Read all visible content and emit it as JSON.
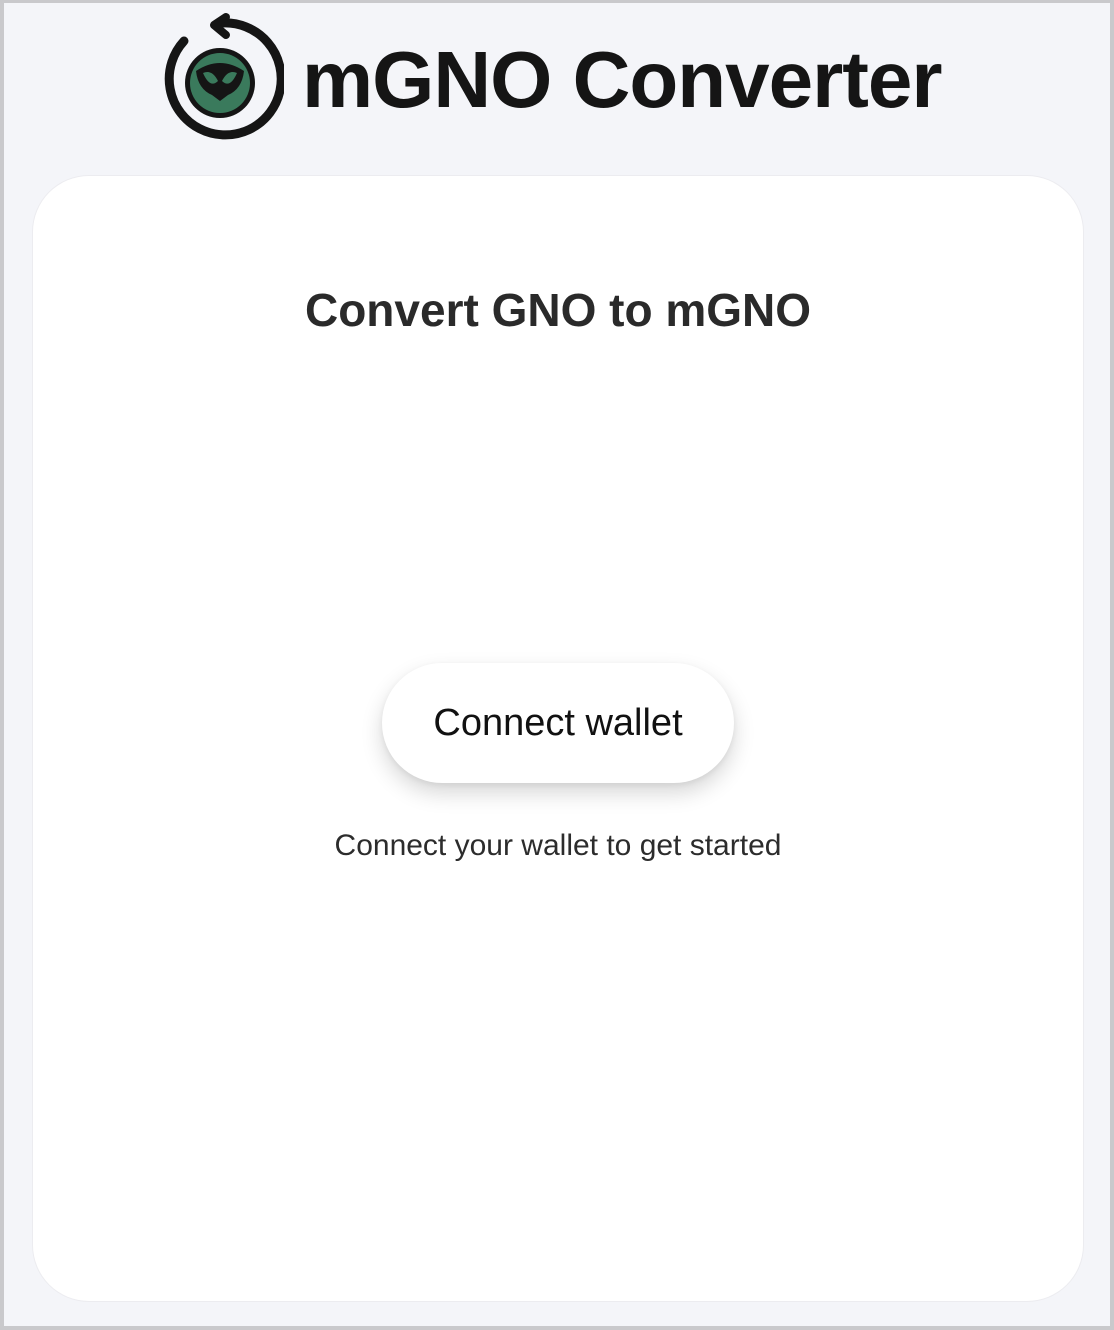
{
  "header": {
    "logo_icon": "gnosis-owl-refresh-icon",
    "title": "mGNO Converter"
  },
  "card": {
    "title": "Convert GNO to mGNO",
    "connect_button_label": "Connect wallet",
    "hint": "Connect your wallet to get started"
  },
  "colors": {
    "accent": "#3a7a5c",
    "background": "#f4f5f9",
    "card": "#ffffff",
    "text": "#151515"
  }
}
